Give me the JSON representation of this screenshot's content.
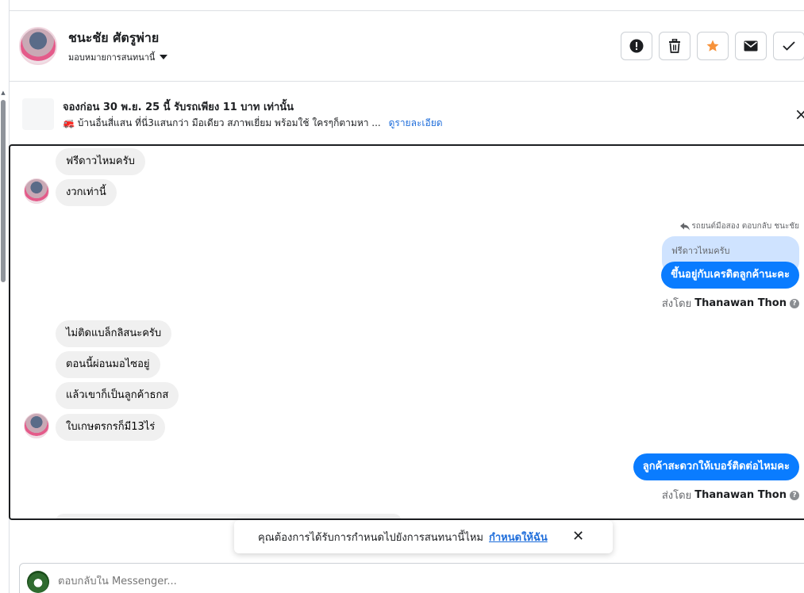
{
  "header": {
    "name": "ชนะชัย ศัตรูพ่าย",
    "assign_label": "มอบหมายการสนทนานี้"
  },
  "banner": {
    "title": "จองก่อน 30 พ.ย. 25 นี้ รับรถเพียง 11 บาท เท่านั้น",
    "description": "🚒 บ้านอื่นสี่แสน ที่นี่3แสนกว่า มือเดียว สภาพเยี่ยม พร้อมใช้ ใครๆก็ตามหา ...",
    "link": "ดูรายละเอียด"
  },
  "messages": {
    "in_1": "ฟรีดาวไหมครับ",
    "in_2": "งวกเท่านี้",
    "reply_label": "รถยนต์มือสอง ตอบกลับ ชนะชัย",
    "quoted": "ฟรีดาวไหมครับ",
    "out_1": "ขึ้นอยู่กับเครดิตลูกค้านะคะ",
    "sent_by_prefix": "ส่งโดย",
    "sent_by_name": "Thanawan Thon",
    "in_3": "ไม่ติดแบล็กลิสนะครับ",
    "in_4": "ตอนนี้ผ่อนมอไซอยู่",
    "in_5": "แล้วเขาก็เป็นลูกค้าธกส",
    "in_6": "ใบเกษตรกรก็มี13ไร่",
    "out_2": "ลูกค้าสะดวกให้เบอร์ติดต่อไหมคะ",
    "sent_by_prefix_2": "ส่งโดย",
    "sent_by_name_2": "Thanawan Thon"
  },
  "toast": {
    "text": "คุณต้องการได้รับการกำหนดไปยังการสนทนานี้ไหม",
    "link": "กำหนดให้ฉัน"
  },
  "composer": {
    "placeholder": "ตอบกลับใน Messenger..."
  },
  "colors": {
    "accent": "#0a7cff",
    "link": "#216fdb",
    "star": "#f7923a"
  }
}
